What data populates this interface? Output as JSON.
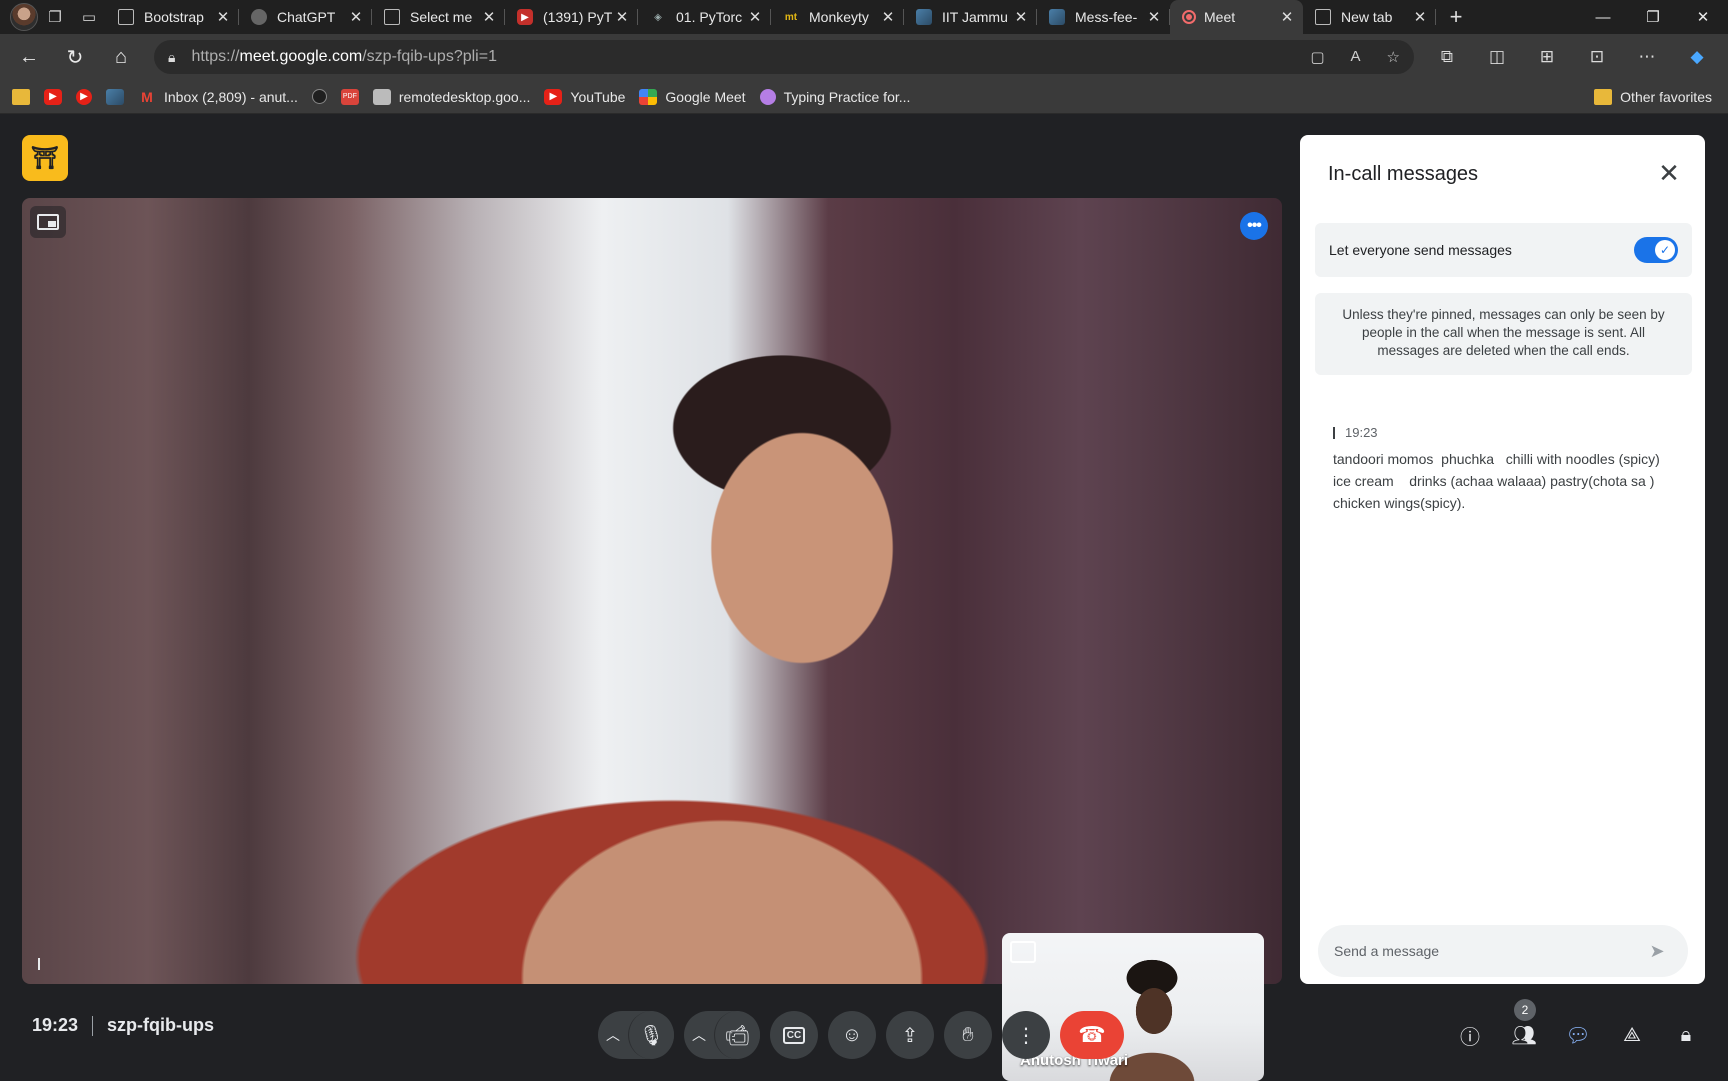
{
  "browser": {
    "tabs": [
      {
        "title": "Bootstrap",
        "favicon": "document-icon",
        "active": false
      },
      {
        "title": "ChatGPT",
        "favicon": "chatgpt-icon",
        "active": false
      },
      {
        "title": "Select me",
        "favicon": "document-icon",
        "active": false
      },
      {
        "title": "(1391) PyT",
        "favicon": "youtube-icon",
        "active": false
      },
      {
        "title": "01. PyTorc",
        "favicon": "pytorch-icon",
        "active": false
      },
      {
        "title": "Monkeyty",
        "favicon": "monkeytype-icon",
        "active": false
      },
      {
        "title": "IIT Jammu",
        "favicon": "image-icon",
        "active": false
      },
      {
        "title": "Mess-fee-",
        "favicon": "image-icon",
        "active": false
      },
      {
        "title": "Meet",
        "favicon": "google-meet-icon",
        "active": true,
        "recording": true
      },
      {
        "title": "New tab",
        "favicon": "new-tab-icon",
        "active": false
      }
    ],
    "url": {
      "prefix": "https://",
      "host": "meet.google.com",
      "path": "/szp-fqib-ups?pli=1"
    },
    "bookmarks": [
      {
        "label": "",
        "icon": "folder-icon"
      },
      {
        "label": "",
        "icon": "youtube-icon"
      },
      {
        "label": "",
        "icon": "youtube-music-icon"
      },
      {
        "label": "",
        "icon": "image-icon"
      },
      {
        "label": "Inbox (2,809) - anut...",
        "icon": "gmail-icon"
      },
      {
        "label": "",
        "icon": "github-icon"
      },
      {
        "label": "",
        "icon": "pdf-icon"
      },
      {
        "label": "remotedesktop.goo...",
        "icon": "remote-desktop-icon"
      },
      {
        "label": "YouTube",
        "icon": "youtube-icon"
      },
      {
        "label": "Google Meet",
        "icon": "google-meet-icon"
      },
      {
        "label": "Typing Practice for...",
        "icon": "typing-icon"
      }
    ],
    "other_favorites": "Other favorites"
  },
  "meet": {
    "time": "19:23",
    "code": "szp-fqib-ups",
    "self_view_name": "Anutosh Tiwari",
    "participants_count": "2",
    "panel": {
      "title": "In-call messages",
      "toggle_label": "Let everyone send messages",
      "toggle_on": true,
      "notice": "Unless they're pinned, messages can only be seen by people in the call when the message is sent. All messages are deleted when the call ends.",
      "messages": [
        {
          "sender": "I",
          "time": "19:23",
          "text": "tandoori momos  phuchka   chilli with noodles (spicy)     ice cream    drinks (achaa walaaa) pastry(chota sa )    chicken wings(spicy)."
        }
      ],
      "compose_placeholder": "Send a message"
    },
    "colors": {
      "accent": "#1a73e8",
      "end_call": "#ea4335",
      "host_badge": "#f9bb1c",
      "background": "#202124"
    }
  }
}
